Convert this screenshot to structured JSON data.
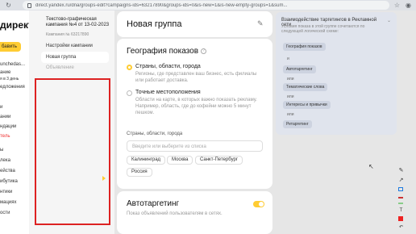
{
  "browser": {
    "url": "direct.yandex.ru/dna/groups-edit?campaigns-ids=63217890&groups-ids=0&is-new=1&is-new-empty-groups=1&sum..."
  },
  "leftnav": {
    "logo": "директ",
    "add": "бавить",
    "items": [
      "unchedas...",
      "ание",
      "я в 3 день",
      "едложения",
      "и",
      "ании",
      "ндации",
      "тель",
      "ы",
      "лека",
      "ейства",
      "ибутика",
      "нтики",
      "мациях",
      "ости"
    ]
  },
  "campaign": {
    "name": "Текстово-графическая кампания №4 от 13-02-2023",
    "number": "Кампания № 63217890",
    "items": [
      "Настройки кампании",
      "Новая группа",
      "Объявление"
    ]
  },
  "group": {
    "title": "Новая группа"
  },
  "geo": {
    "title": "География показов",
    "options": [
      {
        "label": "Страны, области, города",
        "desc": "Регионы, где представлен ваш бизнес, есть филиалы или работает доставка."
      },
      {
        "label": "Точные местоположения",
        "desc": "Области на карте, в которых важно показать рекламу. Например, область, где до кофейни можно 5 минут пешком."
      }
    ],
    "field_label": "Страны, области, города",
    "placeholder": "Введите или выберите из списка",
    "chips": [
      "Калининград",
      "Москва",
      "Санкт-Петербург",
      "Россия"
    ]
  },
  "auto": {
    "title": "Автотаргетинг",
    "desc": "Показ объявлений пользователям в сетях."
  },
  "rpanel": {
    "title": "Взаимодействие таргетингов в Рекламной сети",
    "subtitle": "Условия показа в этой группе сочетаются по следующей логической схеме:",
    "chips": [
      "География показов",
      "Автотаргетинг",
      "Тематические слова",
      "Интересы и привычки",
      "Ретаргетинг"
    ],
    "and": "и",
    "or": "или"
  }
}
